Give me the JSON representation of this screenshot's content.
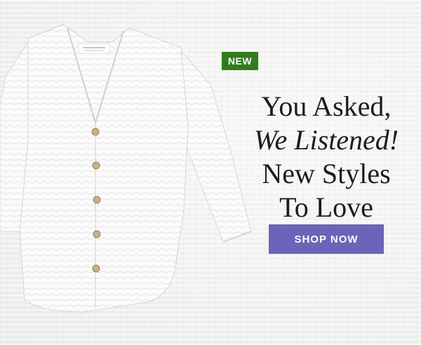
{
  "badge": {
    "label": "NEW",
    "color": "#2f7d1f"
  },
  "headline": {
    "line1": "You Asked,",
    "line2": "We Listened!",
    "line3": "New Styles",
    "line4": "To Love"
  },
  "cta": {
    "label": "SHOP NOW",
    "color": "#6a65b8"
  },
  "product": {
    "icon": "white-blouse-image"
  }
}
